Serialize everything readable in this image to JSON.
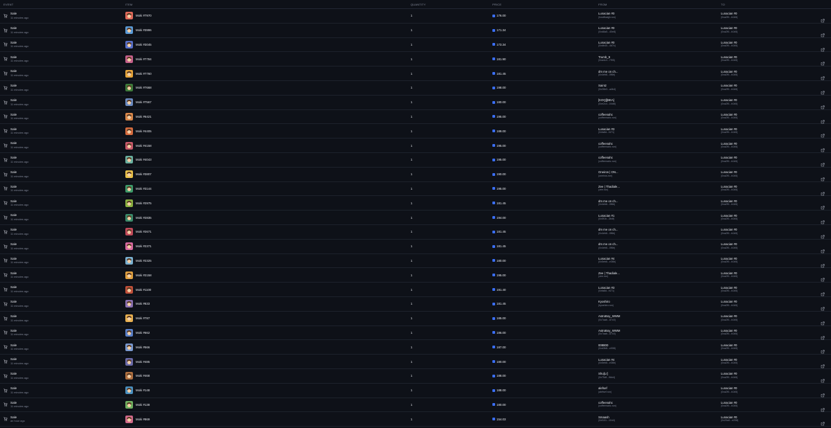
{
  "header": {
    "event": "EVENT",
    "item": "ITEM",
    "quantity": "QUANTITY",
    "price": "PRICE",
    "from": "FROM",
    "to": "TO"
  },
  "colors": {
    "background": "#0e1118",
    "ron_accent": "#3a6ef5",
    "muted_text": "#7f8596"
  },
  "icons": {
    "event": "cart-icon",
    "price": "ron-token-icon",
    "link": "external-link-icon"
  },
  "rows": [
    {
      "event": "Sale",
      "time": "11 minutes ago",
      "item": "Moki #7970",
      "quantity": "1",
      "price": "176.00",
      "from_name": "Lunacian #0",
      "from_addr": "(hostfkaigh.ron)",
      "to_name": "Lunacian #0",
      "to_addr": "(0xa2f0...b1b5)",
      "thumb": "#e06a5a"
    },
    {
      "event": "Sale",
      "time": "11 minutes ago",
      "item": "Moki #3996",
      "quantity": "1",
      "price": "171.34",
      "from_name": "Lunacian #0",
      "from_addr": "(0xd8a5...40e8)",
      "to_name": "Lunacian #0",
      "to_addr": "(0xa2f0...b1b5)",
      "thumb": "#5a9ad6"
    },
    {
      "event": "Sale",
      "time": "11 minutes ago",
      "item": "Moki #3045",
      "quantity": "1",
      "price": "173.34",
      "from_name": "Lunacian #0",
      "from_addr": "(0xdb40...4d7c)",
      "to_name": "Lunacian #0",
      "to_addr": "(0xa2f0...b1b5)",
      "thumb": "#5870c9"
    },
    {
      "event": "Sale",
      "time": "11 minutes ago",
      "item": "Moki #7784",
      "quantity": "1",
      "price": "181.90",
      "from_name": "Trumb_9",
      "from_addr": "(0xa4c4...7f95)",
      "to_name": "Lunacian #0",
      "to_addr": "(0xa2f0...b1b5)",
      "thumb": "#c4608a"
    },
    {
      "event": "Sale",
      "time": "11 minutes ago",
      "item": "Moki #7760",
      "quantity": "1",
      "price": "181.45",
      "from_name": "dm me on ch...",
      "from_addr": "(0x4eb6...0f6b)",
      "to_name": "Lunacian #0",
      "to_addr": "(0xa2f0...b1b5)",
      "thumb": "#e6a43a"
    },
    {
      "event": "Sale",
      "time": "11 minutes ago",
      "item": "Moki #7668",
      "quantity": "1",
      "price": "198.00",
      "from_name": "Saintz",
      "from_addr": "(0x26b3...a4b4)",
      "to_name": "Lunacian #0",
      "to_addr": "(0xa2f0...b1b5)",
      "thumb": "#3e7a3a"
    },
    {
      "event": "Sale",
      "time": "11 minutes ago",
      "item": "Moki #7567",
      "quantity": "1",
      "price": "180.00",
      "from_name": "[KOQ][BEA]",
      "from_addr": "(0xe2c4...04d8)",
      "to_name": "Lunacian #0",
      "to_addr": "(0xa2f0...b1b5)",
      "thumb": "#6a8ac0"
    },
    {
      "event": "Sale",
      "time": "11 minutes ago",
      "item": "Moki #6421",
      "quantity": "1",
      "price": "195.00",
      "from_name": "coffeenahc",
      "from_addr": "(coffeenahc.ron)",
      "to_name": "Lunacian #0",
      "to_addr": "(0xa2f0...b1b5)",
      "thumb": "#d9874a"
    },
    {
      "event": "Sale",
      "time": "11 minutes ago",
      "item": "Moki #4405",
      "quantity": "1",
      "price": "189.00",
      "from_name": "Lunacian #3",
      "from_addr": "(0xfa8d...f471)",
      "to_name": "Lunacian #0",
      "to_addr": "(0xa2f0...b1b5)",
      "thumb": "#d46b3e"
    },
    {
      "event": "Sale",
      "time": "11 minutes ago",
      "item": "Moki #4158",
      "quantity": "1",
      "price": "195.00",
      "from_name": "coffeenahc",
      "from_addr": "(coffeenahc.ron)",
      "to_name": "Lunacian #0",
      "to_addr": "(0xa2f0...b1b5)",
      "thumb": "#c85a6a"
    },
    {
      "event": "Sale",
      "time": "11 minutes ago",
      "item": "Moki #4043",
      "quantity": "1",
      "price": "195.00",
      "from_name": "coffeenahc",
      "from_addr": "(coffeenahc.ron)",
      "to_name": "Lunacian #0",
      "to_addr": "(0xa2f0...b1b5)",
      "thumb": "#6ab0a0"
    },
    {
      "event": "Sale",
      "time": "11 minutes ago",
      "item": "Moki #3807",
      "quantity": "1",
      "price": "190.00",
      "from_name": "Oneiros | ON...",
      "from_addr": "(oneiros.ron)",
      "to_name": "Lunacian #0",
      "to_addr": "(0xa2f0...b1b5)",
      "thumb": "#e8c04a"
    },
    {
      "event": "Sale",
      "time": "11 minutes ago",
      "item": "Moki #3144",
      "quantity": "1",
      "price": "195.00",
      "from_name": "Zee | Thadiale...",
      "from_addr": "(zee.ron)",
      "to_name": "Lunacian #0",
      "to_addr": "(0xa2f0...b1b5)",
      "thumb": "#3e9a6a"
    },
    {
      "event": "Sale",
      "time": "11 minutes ago",
      "item": "Moki #2975",
      "quantity": "1",
      "price": "181.45",
      "from_name": "dm me on ch...",
      "from_addr": "(0x4eb6...0f6b)",
      "to_name": "Lunacian #0",
      "to_addr": "(0xa2f0...b1b5)",
      "thumb": "#8ab040"
    },
    {
      "event": "Sale",
      "time": "11 minutes ago",
      "item": "Moki #2835",
      "quantity": "1",
      "price": "194.00",
      "from_name": "Lunacian #1",
      "from_addr": "(0x5f1b...3bdf)",
      "to_name": "Lunacian #0",
      "to_addr": "(0xa2f0...b1b5)",
      "thumb": "#3a8a6a"
    },
    {
      "event": "Sale",
      "time": "11 minutes ago",
      "item": "Moki #2671",
      "quantity": "1",
      "price": "181.45",
      "from_name": "dm me on ch...",
      "from_addr": "(0x4eb6...0f6b)",
      "to_name": "Lunacian #0",
      "to_addr": "(0xa2f0...b1b5)",
      "thumb": "#c04a5a"
    },
    {
      "event": "Sale",
      "time": "11 minutes ago",
      "item": "Moki #2371",
      "quantity": "1",
      "price": "181.45",
      "from_name": "dm me on ch...",
      "from_addr": "(0x4eb6...0f6b)",
      "to_name": "Lunacian #0",
      "to_addr": "(0xa2f0...b1b5)",
      "thumb": "#d86aa0"
    },
    {
      "event": "Sale",
      "time": "11 minutes ago",
      "item": "Moki #2325",
      "quantity": "1",
      "price": "180.00",
      "from_name": "Lunacian #4",
      "from_addr": "(0x5eb6...e36b)",
      "to_name": "Lunacian #0",
      "to_addr": "(0xa2f0...b1b5)",
      "thumb": "#7ab0d0"
    },
    {
      "event": "Sale",
      "time": "11 minutes ago",
      "item": "Moki #2158",
      "quantity": "1",
      "price": "195.00",
      "from_name": "Zee | Thadiale...",
      "from_addr": "(zee.ron)",
      "to_name": "Lunacian #0",
      "to_addr": "(0xa2f0...b1b5)",
      "thumb": "#e0a040"
    },
    {
      "event": "Sale",
      "time": "11 minutes ago",
      "item": "Moki #1100",
      "quantity": "1",
      "price": "191.40",
      "from_name": "Lunacian #3",
      "from_addr": "(0xfa8d...f471)",
      "to_name": "Lunacian #0",
      "to_addr": "(0xa2f0...b1b5)",
      "thumb": "#c0503a"
    },
    {
      "event": "Sale",
      "time": "11 minutes ago",
      "item": "Moki #833",
      "quantity": "1",
      "price": "181.45",
      "from_name": "Kyoshiro",
      "from_addr": "(kyoshiro.ron)",
      "to_name": "Lunacian #0",
      "to_addr": "(0xa2f0...b1b5)",
      "thumb": "#8a70b0"
    },
    {
      "event": "Sale",
      "time": "11 minutes ago",
      "item": "Moki #787",
      "quantity": "1",
      "price": "185.00",
      "from_name": "AstroBoy_WWM",
      "from_addr": "(0x7aab...87c0)",
      "to_name": "Lunacian #0",
      "to_addr": "(0xa2f0...b1b5)",
      "thumb": "#e8b050"
    },
    {
      "event": "Sale",
      "time": "11 minutes ago",
      "item": "Moki #662",
      "quantity": "1",
      "price": "186.00",
      "from_name": "AstroBoy_WWM",
      "from_addr": "(0x7aab...87c0)",
      "to_name": "Lunacian #0",
      "to_addr": "(0xa2f0...b1b5)",
      "thumb": "#5a80c8"
    },
    {
      "event": "Sale",
      "time": "11 minutes ago",
      "item": "Moki #566",
      "quantity": "1",
      "price": "187.00",
      "from_name": "008800",
      "from_addr": "(0xd3b8...c008)",
      "to_name": "Lunacian #0",
      "to_addr": "(0xa2f0...b1b5)",
      "thumb": "#7a9ad0"
    },
    {
      "event": "Sale",
      "time": "11 minutes ago",
      "item": "Moki #485",
      "quantity": "1",
      "price": "180.00",
      "from_name": "Lunacian #4",
      "from_addr": "(0x5eb6...e36b)",
      "to_name": "Lunacian #0",
      "to_addr": "(0xa2f0...b1b5)",
      "thumb": "#6a6aa8"
    },
    {
      "event": "Sale",
      "time": "11 minutes ago",
      "item": "Moki #468",
      "quantity": "1",
      "price": "188.00",
      "from_name": "Shu[Lr]",
      "from_addr": "(0x75df...9bb4)",
      "to_name": "Lunacian #0",
      "to_addr": "(0xa2f0...b1b5)",
      "thumb": "#b07040"
    },
    {
      "event": "Sale",
      "time": "11 minutes ago",
      "item": "Moki #148",
      "quantity": "1",
      "price": "188.00",
      "from_name": "alefsef",
      "from_addr": "(alefsef.ron)",
      "to_name": "Lunacian #0",
      "to_addr": "(0xa2f0...b1b5)",
      "thumb": "#4a90c0"
    },
    {
      "event": "Sale",
      "time": "11 minutes ago",
      "item": "Moki #138",
      "quantity": "1",
      "price": "180.00",
      "from_name": "coffeenahc",
      "from_addr": "(coffeenahc.ron)",
      "to_name": "Lunacian #0",
      "to_addr": "(0xa2f0...b1b5)",
      "thumb": "#70b060"
    },
    {
      "event": "Sale",
      "time": "an hour ago",
      "item": "Moki #869",
      "quantity": "1",
      "price": "154.03",
      "from_name": "Smaash",
      "from_addr": "(0xf101...11b4)",
      "to_name": "Lunacian #0",
      "to_addr": "(0x20a0...e208)",
      "thumb": "#d06a8a"
    }
  ]
}
